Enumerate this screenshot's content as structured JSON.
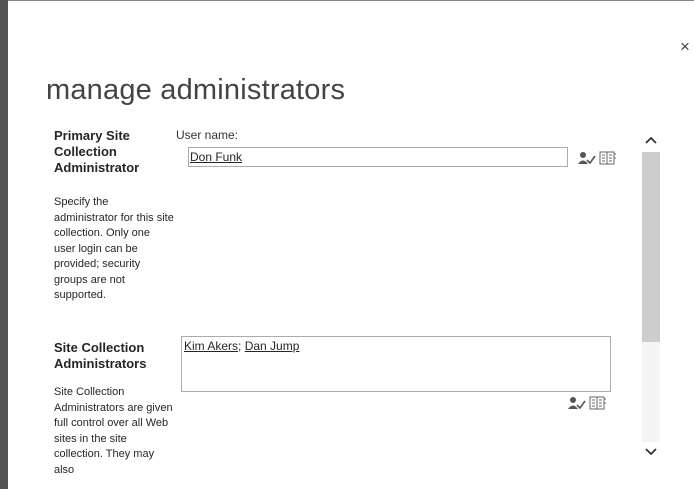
{
  "dialog": {
    "title": "manage administrators",
    "close_label": "×"
  },
  "primary_admin": {
    "heading": "Primary Site Collection Administrator",
    "description": "Specify the administrator for this site collection. Only one user login can be provided; security groups are not supported.",
    "field_label": "User name:",
    "users": [
      "Don Funk"
    ],
    "icons": [
      "check-names-icon",
      "address-book-icon"
    ]
  },
  "site_admins": {
    "heading": "Site Collection Administrators",
    "description": "Site Collection Administrators are given full control over all Web sites in the site collection. They may also",
    "users": [
      "Kim Akers",
      "Dan Jump"
    ],
    "separator": "; ",
    "icons": [
      "check-names-icon",
      "address-book-icon"
    ]
  },
  "scrollbar": {
    "up_label": "^",
    "down_label": "⌄"
  },
  "colors": {
    "left_bar": "#555555",
    "title": "#444444",
    "input_border": "#ababab",
    "scroll_thumb": "#cdcdcd"
  }
}
